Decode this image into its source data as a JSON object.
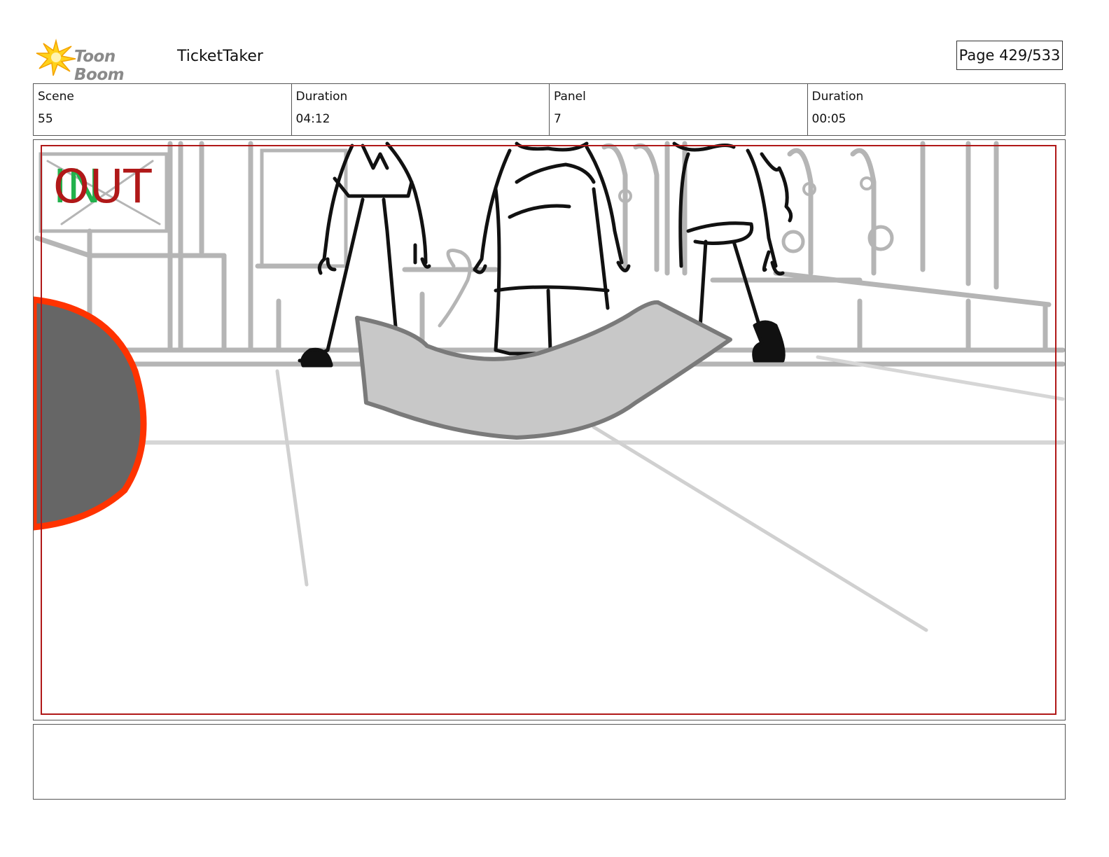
{
  "header": {
    "logo_text": "Toon Boom",
    "project_title": "TicketTaker",
    "page_label": "Page 429/533"
  },
  "info": [
    {
      "label": "Scene",
      "value": "55"
    },
    {
      "label": "Duration",
      "value": "04:12"
    },
    {
      "label": "Panel",
      "value": "7"
    },
    {
      "label": "Duration",
      "value": "00:05"
    }
  ],
  "panel": {
    "in_marker": "IN",
    "out_marker": "OUT",
    "colors": {
      "in_marker": "#22b14c",
      "out_marker": "#b01818",
      "safe_frame": "#b01818",
      "disc_fill": "#666666",
      "disc_outline": "#ff3300",
      "carpet_fill": "#c8c8c8",
      "background_sketch": "#b5b5b5"
    }
  },
  "notes": {
    "text": ""
  }
}
